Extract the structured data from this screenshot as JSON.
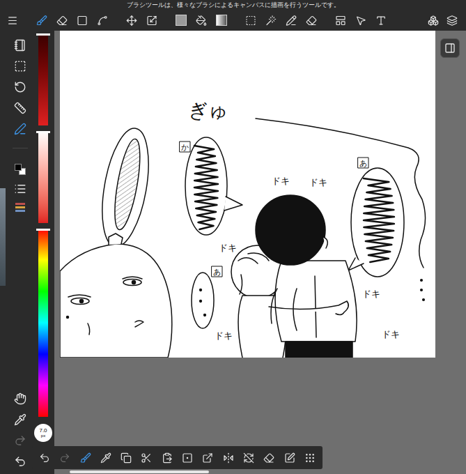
{
  "tooltip": "ブラシツールは、様々なブラシによるキャンバスに描画を行うツールです。",
  "top_toolbar": {
    "tools": [
      {
        "selected": false
      },
      {
        "selected": true
      },
      {
        "selected": false
      },
      {
        "selected": false
      },
      {
        "selected": false
      },
      {
        "selected": false
      },
      {
        "selected": false
      },
      {
        "selected": false
      },
      {
        "selected": false
      },
      {
        "selected": false
      },
      {
        "selected": false
      },
      {
        "selected": false
      },
      {
        "selected": false
      },
      {
        "selected": false
      },
      {
        "selected": false
      },
      {
        "selected": false
      },
      {
        "selected": false
      },
      {
        "selected": false
      },
      {
        "selected": false
      }
    ]
  },
  "left_sidebar": {
    "items": [
      {
        "selected": false
      },
      {
        "selected": false
      },
      {
        "selected": false
      },
      {
        "selected": false
      },
      {
        "selected": true
      }
    ],
    "bottom": [
      {
        "disabled": false
      },
      {
        "disabled": false
      },
      {
        "disabled": true
      },
      {
        "disabled": false
      }
    ]
  },
  "colors": {
    "primary": "#000000",
    "secondary": "#ffffff"
  },
  "sliders": [
    {
      "level": 0
    },
    {
      "level": 0
    },
    {
      "level": 0
    }
  ],
  "brush_size": {
    "value": "7.0",
    "unit": "px"
  },
  "canvas": {
    "texts": [
      {
        "text": "ぎゅ",
        "kind": "plain"
      },
      {
        "text": "か",
        "kind": "boxed"
      },
      {
        "text": "ドキ",
        "kind": "plain"
      },
      {
        "text": "ドキ",
        "kind": "plain"
      },
      {
        "text": "あ",
        "kind": "boxed"
      },
      {
        "text": "ドキ",
        "kind": "plain"
      },
      {
        "text": "あ",
        "kind": "boxed"
      },
      {
        "text": "ドキ",
        "kind": "plain"
      },
      {
        "text": "ドキ",
        "kind": "plain"
      },
      {
        "text": "ドキ",
        "kind": "plain"
      }
    ]
  },
  "bottom_toolbar": {
    "tools": [
      {
        "selected": false,
        "disabled": false
      },
      {
        "selected": false,
        "disabled": true
      },
      {
        "selected": true,
        "disabled": false
      },
      {
        "selected": false,
        "disabled": false
      },
      {
        "selected": false,
        "disabled": false
      },
      {
        "selected": false,
        "disabled": false
      },
      {
        "selected": false,
        "disabled": false
      },
      {
        "selected": false,
        "disabled": false
      },
      {
        "selected": false,
        "disabled": false
      },
      {
        "selected": false,
        "disabled": false
      },
      {
        "selected": false,
        "disabled": false
      },
      {
        "selected": false,
        "disabled": false
      },
      {
        "selected": false,
        "disabled": false
      },
      {
        "selected": false,
        "disabled": false
      }
    ]
  }
}
